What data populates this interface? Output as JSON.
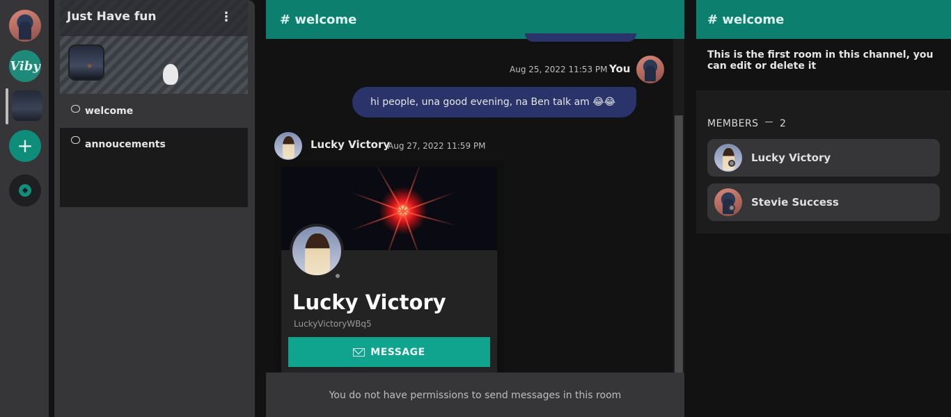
{
  "server": {
    "name": "Just Have fun",
    "more_label": "⋮",
    "rail_logo": "Viby",
    "add_label": "+"
  },
  "channels": [
    {
      "name": "welcome"
    },
    {
      "name": "annoucements"
    }
  ],
  "chat": {
    "header": "# welcome",
    "messages": [
      {
        "author": "You",
        "time": "Aug 25, 2022 11:53 PM",
        "text": "hi people, una good evening, na Ben talk am",
        "emojis": [
          "😂",
          "😂"
        ]
      },
      {
        "author": "Lucky Victory",
        "time": "Aug 27, 2022 11:59 PM"
      }
    ],
    "footer": "You do not have permissions to send messages in this room"
  },
  "profile_card": {
    "name": "Lucky Victory",
    "handle": "LuckyVictoryWBq5",
    "button_label": "MESSAGE"
  },
  "room_panel": {
    "header": "# welcome",
    "description": "This is the first room in this channel, you can edit or delete it",
    "members_label": "MEMBERS",
    "members_sep": "—",
    "members_count": "2",
    "members": [
      {
        "name": "Lucky Victory"
      },
      {
        "name": "Stevie Success"
      }
    ]
  },
  "colors": {
    "accent": "#0c7f6f",
    "button": "#10a38e",
    "bubble": "#2a346a",
    "panel": "#363638",
    "background": "#121212"
  },
  "icons": [
    "chat-bubble-icon",
    "mail-icon",
    "compass-icon",
    "plus-icon",
    "more-vertical-icon"
  ]
}
